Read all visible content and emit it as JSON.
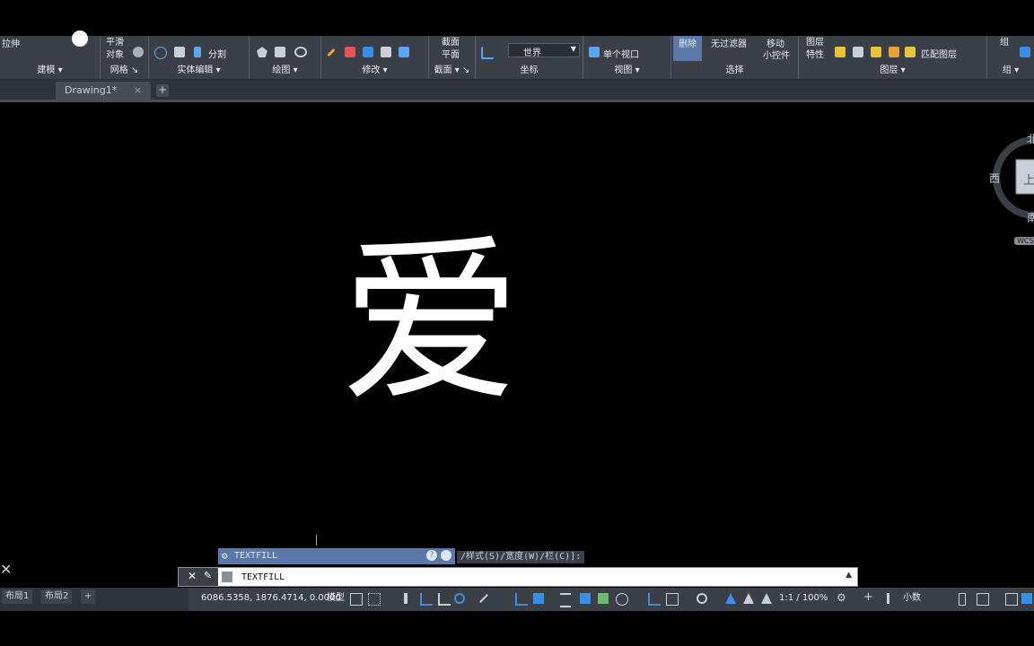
{
  "ribbon": {
    "top_row": {
      "extrude": "拉伸",
      "smooth_line1": "平滑",
      "smooth_line2": "对象",
      "split": "分割",
      "section_line1": "截面",
      "section_line2": "平面",
      "ucs_world": "世界",
      "single_viewport": "单个视口",
      "remove": "删除",
      "no_filter": "无过滤器",
      "move_line1": "移动",
      "move_line2": "小控件",
      "layer_props_line1": "图层",
      "layer_props_line2": "特性",
      "match_layer": "匹配图层",
      "group": "组"
    },
    "panels": [
      {
        "label": "建模 ▾"
      },
      {
        "label": "网格 ↘"
      },
      {
        "label": "实体编辑 ▾"
      },
      {
        "label": "绘图 ▾"
      },
      {
        "label": "修改 ▾"
      },
      {
        "label": "截面 ▾ ↘"
      },
      {
        "label": "坐标"
      },
      {
        "label": "视图 ▾"
      },
      {
        "label": "选择"
      },
      {
        "label": "图层 ▾"
      },
      {
        "label": "组 ▾"
      }
    ]
  },
  "tabs": {
    "drawing": "Drawing1*",
    "close": "×",
    "add": "+"
  },
  "canvas": {
    "text_glyph": "爱",
    "viewcube": {
      "north": "北",
      "west": "西",
      "south": "南",
      "face": "上",
      "wcs": "WCS"
    }
  },
  "command": {
    "hint": "TEXTFILL",
    "options": "/样式(S)/宽度(W)/栏(C)]:",
    "input_value": "TEXTFILL"
  },
  "status": {
    "layouts": [
      "布局1",
      "布局2"
    ],
    "add_layout": "+",
    "coordinates": "6086.5358, 1876.4714, 0.0000",
    "model": "模型",
    "scale": "1:1 / 100%",
    "units": "小数"
  },
  "colors": {
    "ribbon_bg": "#3b3f47",
    "command_hint_bg": "#5a78a8",
    "accent_blue": "#3a8ee6"
  }
}
